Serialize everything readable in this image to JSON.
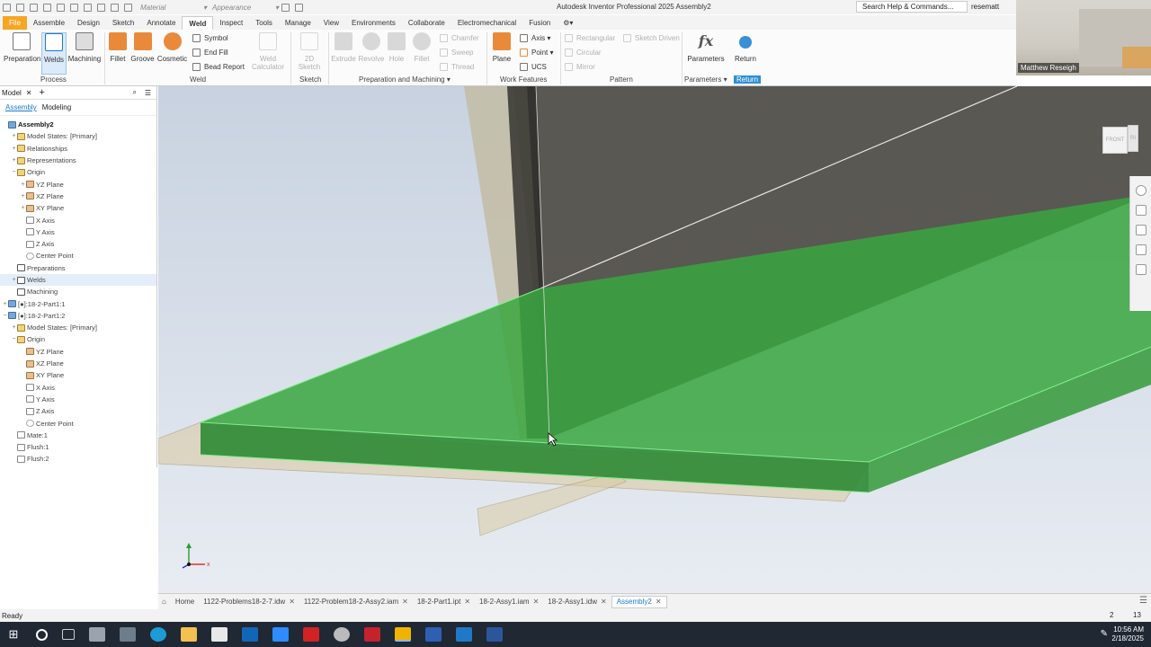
{
  "qat": {
    "material": "Material",
    "appearance": "Appearance",
    "title": "Autodesk Inventor Professional 2025    Assembly2",
    "search_placeholder": "Search Help & Commands...",
    "user": "resematt"
  },
  "menu_tabs": [
    "File",
    "Assemble",
    "Design",
    "Sketch",
    "Annotate",
    "Weld",
    "Inspect",
    "Tools",
    "Manage",
    "View",
    "Environments",
    "Collaborate",
    "Electromechanical",
    "Fusion"
  ],
  "ribbon": {
    "process": {
      "preparation": "Preparation",
      "welds": "Welds",
      "machining": "Machining",
      "label": "Process"
    },
    "weld": {
      "fillet": "Fillet",
      "groove": "Groove",
      "cosmetic": "Cosmetic",
      "symbol": "Symbol",
      "end_fill": "End Fill",
      "bead_report": "Bead Report",
      "weld_calculator": "Weld Calculator",
      "label": "Weld"
    },
    "sketch": {
      "sketch_2d": "2D Sketch",
      "label": "Sketch"
    },
    "prep_mach": {
      "extrude": "Extrude",
      "revolve": "Revolve",
      "hole": "Hole",
      "fillet": "Fillet",
      "chamfer": "Chamfer",
      "sweep": "Sweep",
      "thread": "Thread",
      "label": "Preparation and Machining"
    },
    "work_features": {
      "plane": "Plane",
      "axis": "Axis",
      "point": "Point",
      "ucs": "UCS",
      "label": "Work Features"
    },
    "pattern": {
      "rectangular": "Rectangular",
      "circular": "Circular",
      "mirror": "Mirror",
      "sketch_driven": "Sketch Driven",
      "label": "Pattern"
    },
    "parameters": {
      "parameters": "Parameters",
      "label": "Parameters"
    },
    "return": {
      "return": "Return",
      "label": "Return"
    }
  },
  "browser": {
    "tab": "Model",
    "sub_assembly": "Assembly",
    "sub_modeling": "Modeling",
    "tree": [
      {
        "label": "Assembly2",
        "icon": "assembly",
        "indent": 0,
        "bold": true
      },
      {
        "label": "Model States: [Primary]",
        "icon": "folder",
        "indent": 1,
        "exp": "+"
      },
      {
        "label": "Relationships",
        "icon": "folder",
        "indent": 1,
        "exp": "+"
      },
      {
        "label": "Representations",
        "icon": "folder",
        "indent": 1,
        "exp": "+"
      },
      {
        "label": "Origin",
        "icon": "folder",
        "indent": 1,
        "exp": "−"
      },
      {
        "label": "YZ Plane",
        "icon": "plane",
        "indent": 2,
        "exp": "+"
      },
      {
        "label": "XZ Plane",
        "icon": "plane",
        "indent": 2,
        "exp": "+"
      },
      {
        "label": "XY Plane",
        "icon": "plane",
        "indent": 2,
        "exp": "+"
      },
      {
        "label": "X Axis",
        "icon": "axis",
        "indent": 2
      },
      {
        "label": "Y Axis",
        "icon": "axis",
        "indent": 2
      },
      {
        "label": "Z Axis",
        "icon": "axis",
        "indent": 2
      },
      {
        "label": "Center Point",
        "icon": "point",
        "indent": 2
      },
      {
        "label": "Preparations",
        "icon": "weld",
        "indent": 1
      },
      {
        "label": "Welds",
        "icon": "weld",
        "indent": 1,
        "exp": "+",
        "sel": true
      },
      {
        "label": "Machining",
        "icon": "weld",
        "indent": 1
      },
      {
        "label": "[●]:18-2-Part1:1",
        "icon": "part",
        "indent": 0,
        "exp": "+"
      },
      {
        "label": "[●]:18-2-Part1:2",
        "icon": "part",
        "indent": 0,
        "exp": "−"
      },
      {
        "label": "Model States: [Primary]",
        "icon": "folder",
        "indent": 1,
        "exp": "+"
      },
      {
        "label": "Origin",
        "icon": "folder",
        "indent": 1,
        "exp": "−"
      },
      {
        "label": "YZ Plane",
        "icon": "plane",
        "indent": 2
      },
      {
        "label": "XZ Plane",
        "icon": "plane",
        "indent": 2
      },
      {
        "label": "XY Plane",
        "icon": "plane",
        "indent": 2
      },
      {
        "label": "X Axis",
        "icon": "axis",
        "indent": 2
      },
      {
        "label": "Y Axis",
        "icon": "axis",
        "indent": 2
      },
      {
        "label": "Z Axis",
        "icon": "axis",
        "indent": 2
      },
      {
        "label": "Center Point",
        "icon": "point",
        "indent": 2
      },
      {
        "label": "Mate:1",
        "icon": "axis",
        "indent": 1
      },
      {
        "label": "Flush:1",
        "icon": "axis",
        "indent": 1
      },
      {
        "label": "Flush:2",
        "icon": "axis",
        "indent": 1
      }
    ]
  },
  "viewcube": {
    "front": "FRONT",
    "right": "RI"
  },
  "document_tabs": [
    {
      "label": "Home",
      "active": false,
      "closable": false
    },
    {
      "label": "1122-Problems18-2-7.idw",
      "active": false,
      "closable": true
    },
    {
      "label": "1122-Problem18-2-Assy2.iam",
      "active": false,
      "closable": true
    },
    {
      "label": "18-2-Part1.ipt",
      "active": false,
      "closable": true
    },
    {
      "label": "18-2-Assy1.iam",
      "active": false,
      "closable": true
    },
    {
      "label": "18-2-Assy1.idw",
      "active": false,
      "closable": true
    },
    {
      "label": "Assembly2",
      "active": true,
      "closable": true
    }
  ],
  "status": {
    "text": "Ready",
    "num1": "2",
    "num2": "13"
  },
  "clock": {
    "time": "10:56 AM",
    "date": "2/18/2025"
  },
  "webcam": {
    "name": "Matthew Reseigh"
  },
  "colors": {
    "file_tab": "#f5a623",
    "accent": "#2d8fd5",
    "weld_green": "#3aa640"
  }
}
